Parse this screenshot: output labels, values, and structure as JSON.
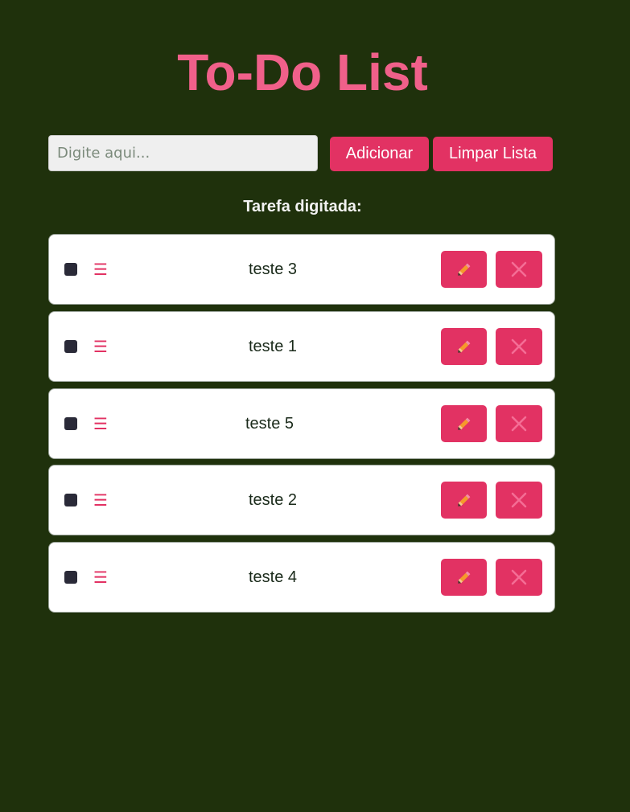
{
  "app": {
    "title": "To-Do List"
  },
  "input": {
    "placeholder": "Digite aqui...",
    "value": ""
  },
  "buttons": {
    "add_label": "Adicionar",
    "clear_label": "Limpar Lista"
  },
  "typed_label": "Tarefa digitada:",
  "tasks": [
    {
      "text": "teste 3",
      "checked": false
    },
    {
      "text": "teste 1",
      "checked": false
    },
    {
      "text": "teste 5",
      "checked": false
    },
    {
      "text": "teste 2",
      "checked": false
    },
    {
      "text": "teste 4",
      "checked": false
    }
  ],
  "icons": {
    "drag": "drag-handle-icon",
    "edit": "pencil-icon",
    "delete": "close-icon"
  },
  "colors": {
    "background": "#1f310c",
    "accent": "#e23263",
    "title": "#f0608a"
  }
}
